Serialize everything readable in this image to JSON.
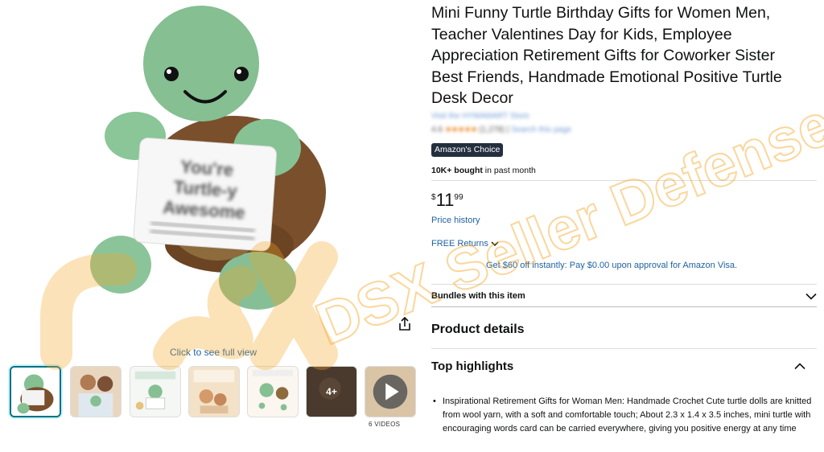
{
  "gallery": {
    "main_image_alt": "Crochet green turtle holding a card",
    "card_text_blurred": "You're Turtle-y Awesome",
    "full_view_label": "Click to see full view",
    "thumbnails": [
      {
        "name": "turtle-main",
        "selected": true
      },
      {
        "name": "person-with-turtle"
      },
      {
        "name": "retirement-gift"
      },
      {
        "name": "valentine-day-gifts"
      },
      {
        "name": "handmade-crochet-turtle"
      },
      {
        "name": "more-images",
        "more_label": "4+"
      },
      {
        "name": "video",
        "videos_label": "6 VIDEOS"
      }
    ]
  },
  "product": {
    "title": "Mini Funny Turtle Birthday Gifts for Women Men, Teacher Valentines Day for Kids, Employee Appreciation Retirement Gifts for Coworker Sister Best Friends, Handmade Emotional Positive Turtle Desk Decor",
    "store_link": "Visit the HYMAMART Store",
    "rating_value": "4.6",
    "rating_stars": "★★★★★",
    "rating_count": "(1,278)",
    "rating_link": "Search this page",
    "badge": "Amazon's Choice",
    "bought_bold": "10K+ bought",
    "bought_rest": " in past month",
    "price_currency": "$",
    "price_whole": "11",
    "price_fraction": "99",
    "price_history": "Price history",
    "returns": "FREE Returns",
    "card_offer": "Get $60 off instantly: Pay $0.00 upon approval for Amazon Visa.",
    "bundles_label": "Bundles with this item",
    "product_details_heading": "Product details",
    "top_highlights_heading": "Top highlights",
    "bullets": [
      "Inspirational Retirement Gifts for Woman Men: Handmade Crochet Cute turtle dolls are knitted from wool yarn, with a soft and comfortable touch; About 2.3 x 1.4 x 3.5 inches, mini turtle with encouraging words card can be carried everywhere, giving you positive energy at any time"
    ]
  },
  "watermark": {
    "text": "DSX Seller Defense"
  },
  "colors": {
    "link": "#2162a1",
    "badge_bg": "#232f3e",
    "thumb_selected": "#007185",
    "watermark": "#f5a623"
  }
}
